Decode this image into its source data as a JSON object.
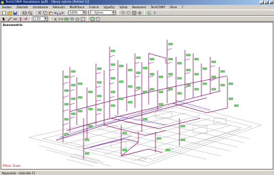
{
  "window": {
    "title": "TechCON® Kanalizace (pdf) - [Nový výkres (Pohled 1)]"
  },
  "menu": [
    "Soubor",
    "Zobrazit",
    "Umisťování",
    "Kótování",
    "Modifikace",
    "Funkce",
    "Výpočty",
    "Výkaz",
    "Nastavení",
    "TechCOMP",
    "Okno",
    "?"
  ],
  "toolbar": {
    "zoom_value": "100%",
    "layer_value": "0 - Výkres",
    "scale_value": "1:50"
  },
  "viewport": {
    "label": "Axonometrie",
    "prompt": "Příkaz: Zoom"
  },
  "statusbar": {
    "text": "Nápověda - stiskněte F1"
  },
  "colors": {
    "pipe": "#8b1a6b",
    "pipe_secondary": "#5a2ad0",
    "label_box": "#66dd66",
    "floorplan": "#9a9a9a"
  }
}
